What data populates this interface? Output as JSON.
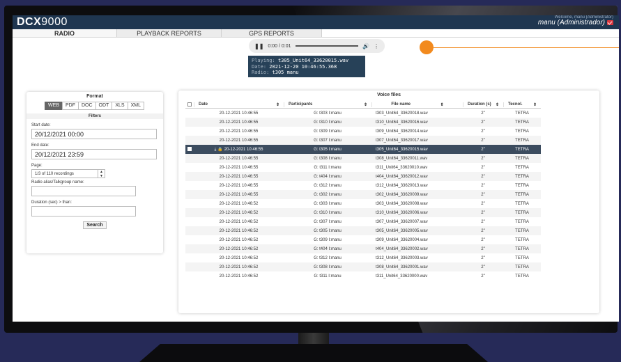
{
  "header": {
    "brand_bold": "DCX",
    "brand_rest": "9000",
    "welcome": "Welcome, manu (Administrator)",
    "user": "manu (Administrador)"
  },
  "tabs": [
    {
      "label": "RADIO",
      "active": true
    },
    {
      "label": "PLAYBACK REPORTS",
      "active": false
    },
    {
      "label": "GPS REPORTS",
      "active": false
    }
  ],
  "player": {
    "time": "0:00 / 0:01",
    "playing_label": "Playing:",
    "playing_value": "t305_Unit64_33620015.wav",
    "date_label": "Date:",
    "date_value": "2021-12-20 10:46:55.368",
    "radio_label": "Radio:",
    "radio_value": "t305 manu"
  },
  "filters_panel": {
    "format_title": "Format",
    "formats": [
      "WEB",
      "PDF",
      "DOC",
      "ODT",
      "XLS",
      "XML"
    ],
    "active_format": "WEB",
    "filters_title": "Filters",
    "start_label": "Start date:",
    "start_value": "20/12/2021 00:00",
    "end_label": "End date:",
    "end_value": "20/12/2021 23:59",
    "page_label": "Page:",
    "page_value": "1/3 of 110 recordings",
    "alias_label": "Radio alias/Talkgroup name:",
    "alias_value": "",
    "duration_label": "Duration (sec) > than:",
    "duration_value": "",
    "search_label": "Search"
  },
  "voice_files": {
    "title": "Voice files",
    "columns": [
      "Date",
      "Participants",
      "File name",
      "Duration (s)",
      "Tecnol."
    ],
    "rows": [
      {
        "date": "20-12-2021 10:46:55",
        "participants": "G: t303 I:manu",
        "file": "t303_Unit64_33620018.wav",
        "duration": "2\"",
        "tech": "TETRA"
      },
      {
        "date": "20-12-2021 10:46:55",
        "participants": "G: t310 I:manu",
        "file": "t310_Unit64_33620016.wav",
        "duration": "2\"",
        "tech": "TETRA"
      },
      {
        "date": "20-12-2021 10:46:55",
        "participants": "G: t309 I:manu",
        "file": "t309_Unit64_33620014.wav",
        "duration": "2\"",
        "tech": "TETRA"
      },
      {
        "date": "20-12-2021 10:46:55",
        "participants": "G: t307 I:manu",
        "file": "t307_Unit64_33620017.wav",
        "duration": "2\"",
        "tech": "TETRA"
      },
      {
        "date": "20-12-2021 10:46:55",
        "participants": "G: t305 I:manu",
        "file": "t305_Unit64_33620015.wav",
        "duration": "2\"",
        "tech": "TETRA",
        "selected": true
      },
      {
        "date": "20-12-2021 10:46:55",
        "participants": "G: t308 I:manu",
        "file": "t308_Unit64_33620011.wav",
        "duration": "2\"",
        "tech": "TETRA"
      },
      {
        "date": "20-12-2021 10:46:55",
        "participants": "G: t311 I:manu",
        "file": "t311_Unit64_33620010.wav",
        "duration": "2\"",
        "tech": "TETRA"
      },
      {
        "date": "20-12-2021 10:46:55",
        "participants": "G: t404 I:manu",
        "file": "t404_Unit64_33620012.wav",
        "duration": "2\"",
        "tech": "TETRA"
      },
      {
        "date": "20-12-2021 10:46:55",
        "participants": "G: t312 I:manu",
        "file": "t312_Unit64_33620013.wav",
        "duration": "2\"",
        "tech": "TETRA"
      },
      {
        "date": "20-12-2021 10:46:55",
        "participants": "G: t302 I:manu",
        "file": "t302_Unit64_33620009.wav",
        "duration": "2\"",
        "tech": "TETRA"
      },
      {
        "date": "20-12-2021 10:46:52",
        "participants": "G: t303 I:manu",
        "file": "t303_Unit64_33620008.wav",
        "duration": "2\"",
        "tech": "TETRA"
      },
      {
        "date": "20-12-2021 10:46:52",
        "participants": "G: t310 I:manu",
        "file": "t310_Unit64_33620006.wav",
        "duration": "2\"",
        "tech": "TETRA"
      },
      {
        "date": "20-12-2021 10:46:52",
        "participants": "G: t307 I:manu",
        "file": "t307_Unit64_33620007.wav",
        "duration": "2\"",
        "tech": "TETRA"
      },
      {
        "date": "20-12-2021 10:46:52",
        "participants": "G: t305 I:manu",
        "file": "t305_Unit64_33620005.wav",
        "duration": "2\"",
        "tech": "TETRA"
      },
      {
        "date": "20-12-2021 10:46:52",
        "participants": "G: t309 I:manu",
        "file": "t309_Unit64_33620004.wav",
        "duration": "2\"",
        "tech": "TETRA"
      },
      {
        "date": "20-12-2021 10:46:52",
        "participants": "G: t404 I:manu",
        "file": "t404_Unit64_33620002.wav",
        "duration": "2\"",
        "tech": "TETRA"
      },
      {
        "date": "20-12-2021 10:46:52",
        "participants": "G: t312 I:manu",
        "file": "t312_Unit64_33620003.wav",
        "duration": "2\"",
        "tech": "TETRA"
      },
      {
        "date": "20-12-2021 10:46:52",
        "participants": "G: t308 I:manu",
        "file": "t308_Unit64_33620001.wav",
        "duration": "2\"",
        "tech": "TETRA"
      },
      {
        "date": "20-12-2021 10:46:52",
        "participants": "G: t311 I:manu",
        "file": "t311_Unit64_33620000.wav",
        "duration": "2\"",
        "tech": "TETRA"
      }
    ]
  },
  "colors": {
    "header_bg": "#1f3650",
    "accent_orange": "#f28a1e",
    "selected_row": "#3c4c5f",
    "background": "#262a58"
  }
}
